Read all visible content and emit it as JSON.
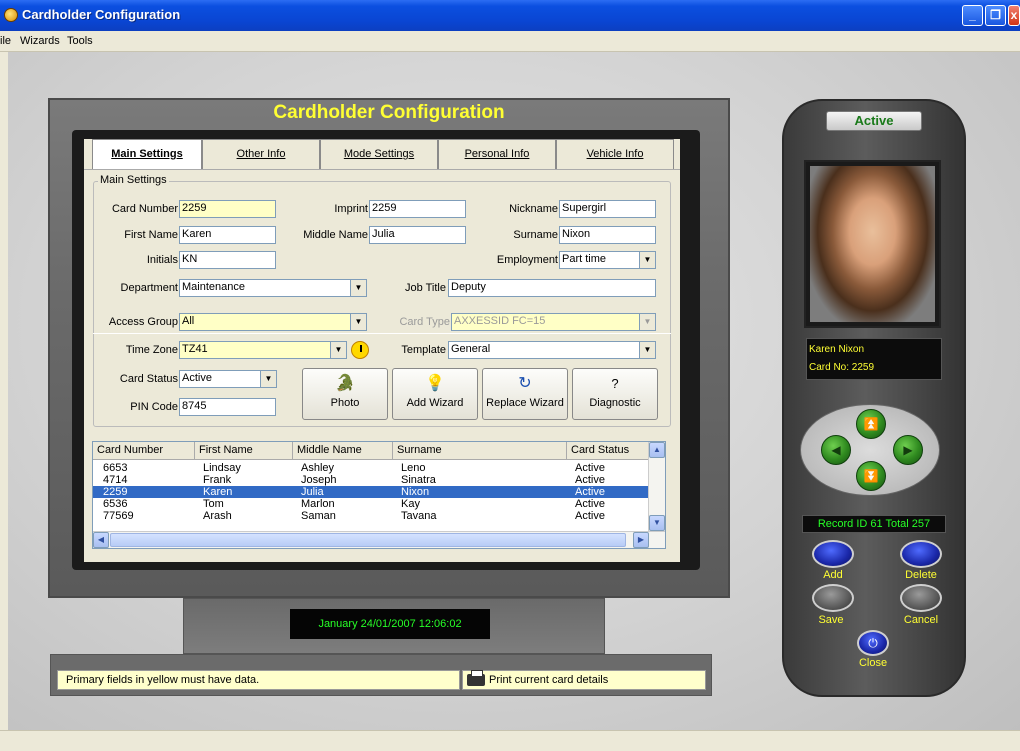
{
  "window": {
    "title": "Cardholder Configuration"
  },
  "menu": [
    "ile",
    "Wizards",
    "Tools"
  ],
  "screen_title": "Cardholder Configuration",
  "tabs": [
    {
      "label": "Main Settings",
      "active": true
    },
    {
      "label": "Other Info",
      "active": false
    },
    {
      "label": "Mode Settings",
      "active": false
    },
    {
      "label": "Personal Info",
      "active": false
    },
    {
      "label": "Vehicle Info",
      "active": false
    }
  ],
  "form": {
    "group_label": "Main Settings",
    "card_number": {
      "label": "Card Number",
      "value": "2259"
    },
    "imprint": {
      "label": "Imprint",
      "value": "2259"
    },
    "nickname": {
      "label": "Nickname",
      "value": "Supergirl"
    },
    "first_name": {
      "label": "First Name",
      "value": "Karen"
    },
    "middle_name": {
      "label": "Middle Name",
      "value": "Julia"
    },
    "surname": {
      "label": "Surname",
      "value": "Nixon"
    },
    "initials": {
      "label": "Initials",
      "value": "KN"
    },
    "employment": {
      "label": "Employment",
      "value": "Part time"
    },
    "department": {
      "label": "Department",
      "value": "Maintenance"
    },
    "job_title": {
      "label": "Job Title",
      "value": "Deputy"
    },
    "access_group": {
      "label": "Access Group",
      "value": "All"
    },
    "card_type": {
      "label": "Card Type",
      "value": "AXXESSID FC=15"
    },
    "time_zone": {
      "label": "Time Zone",
      "value": "TZ41"
    },
    "template": {
      "label": "Template",
      "value": "General"
    },
    "card_status": {
      "label": "Card Status",
      "value": "Active"
    },
    "pin_code": {
      "label": "PIN Code",
      "value": "8745"
    }
  },
  "buttons": {
    "photo": "Photo",
    "add_wizard": "Add Wizard",
    "replace_wizard": "Replace Wizard",
    "diagnostic": "Diagnostic"
  },
  "grid": {
    "columns": [
      "Card Number",
      "First Name",
      "Middle Name",
      "Surname",
      "Card Status"
    ],
    "rows": [
      [
        "6653",
        "Lindsay",
        "Ashley",
        "Leno",
        "Active"
      ],
      [
        "4714",
        "Frank",
        "Joseph",
        "Sinatra",
        "Active"
      ],
      [
        "2259",
        "Karen",
        "Julia",
        "Nixon",
        "Active"
      ],
      [
        "6536",
        "Tom",
        "Marlon",
        "Kay",
        "Active"
      ],
      [
        "77569",
        "Arash",
        "Saman",
        "Tavana",
        "Active"
      ]
    ],
    "selected_index": 2
  },
  "clock": "January  24/01/2007 12:06:02",
  "status_message": "Primary fields in yellow must have data.",
  "print_link": "Print current card details",
  "remote": {
    "status": "Active",
    "name": "Karen Nixon",
    "card_no": "Card No: 2259",
    "record": "Record ID 61 Total 257",
    "add": "Add",
    "delete": "Delete",
    "save": "Save",
    "cancel": "Cancel",
    "close": "Close"
  }
}
